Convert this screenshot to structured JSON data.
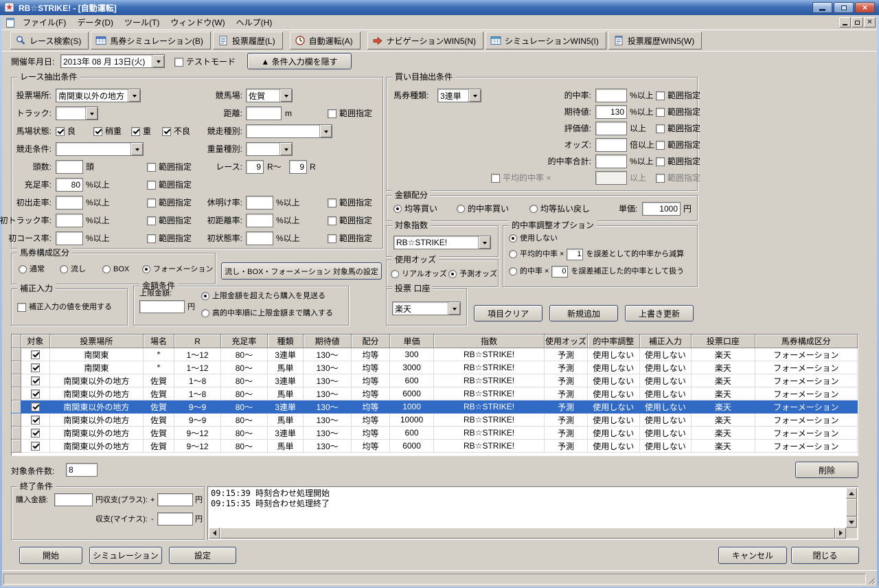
{
  "window": {
    "title": "RB☆STRIKE! - [自動運転]"
  },
  "menubar": {
    "items": [
      "ファイル(F)",
      "データ(D)",
      "ツール(T)",
      "ウィンドウ(W)",
      "ヘルプ(H)"
    ]
  },
  "toolbar": {
    "buttons": [
      {
        "label": "レース検索(S)",
        "icon": "search-icon"
      },
      {
        "label": "馬券シミュレーション(B)",
        "icon": "simulation-icon"
      },
      {
        "label": "投票履歴(L)",
        "icon": "history-icon"
      },
      {
        "label": "自動運転(A)",
        "icon": "clock-icon"
      },
      {
        "label": "ナビゲーションWIN5(N)",
        "icon": "nav-arrow-icon"
      },
      {
        "label": "シミュレーションWIN5(I)",
        "icon": "simulation-win5-icon"
      },
      {
        "label": "投票履歴WIN5(W)",
        "icon": "history-win5-icon"
      }
    ]
  },
  "date_row": {
    "label": "開催年月日:",
    "value": "2013年 08 月 13日(火)",
    "test_mode": "テストモード",
    "hide_button": "▲ 条件入力欄を隠す"
  },
  "labels": {
    "range": "範囲指定"
  },
  "race": {
    "legend": "レース抽出条件",
    "place_label": "投票場所:",
    "place_value": "南関東以外の地方",
    "course_label": "競馬場:",
    "course_value": "佐賀",
    "track_label": "トラック:",
    "track_value": "",
    "dist_label": "距離:",
    "dist_value": "",
    "dist_unit": "m",
    "baba_label": "馬場状態:",
    "baba": [
      "良",
      "稍重",
      "重",
      "不良"
    ],
    "type_label": "競走種別:",
    "type_value": "",
    "cond_label": "競走条件:",
    "cond_value": "",
    "weight_label": "重量種別:",
    "weight_value": "",
    "heads_label": "頭数:",
    "heads_value": "",
    "heads_unit": "頭",
    "raceno_label": "レース:",
    "raceno_from": "9",
    "raceno_mid": "R～",
    "raceno_to": "9",
    "raceno_unit": "R",
    "fill_label": "充足率:",
    "fill_value": "80",
    "fill_unit": "%以上",
    "firstrun_label": "初出走率:",
    "firstrun_value": "",
    "firstrun_unit": "%以上",
    "rest_label": "休明け率:",
    "rest_value": "",
    "rest_unit": "%以上",
    "firsttrack_label": "初トラック率:",
    "firsttrack_value": "",
    "firsttrack_unit": "%以上",
    "firstdist_label": "初距離率:",
    "firstdist_value": "",
    "firstdist_unit": "%以上",
    "firstcourse_label": "初コース率:",
    "firstcourse_value": "",
    "firstcourse_unit": "%以上",
    "firststate_label": "初状態率:",
    "firststate_value": "",
    "firststate_unit": "%以上"
  },
  "bet": {
    "legend": "買い目抽出条件",
    "kind_label": "馬券種類:",
    "kind_value": "3連単",
    "hit_label": "的中率:",
    "hit_value": "",
    "hit_unit": "%以上",
    "expect_label": "期待値:",
    "expect_value": "130",
    "expect_unit": "%以上",
    "eval_label": "評価値:",
    "eval_value": "",
    "eval_unit": "以上",
    "odds_label": "オッズ:",
    "odds_value": "",
    "odds_unit": "倍以上",
    "hitsum_label": "的中率合計:",
    "hitsum_value": "",
    "hitsum_unit": "%以上",
    "avg_label": "平均的中率 ×",
    "avg_value": "",
    "avg_unit": "以上"
  },
  "alloc": {
    "legend": "金額配分",
    "options": [
      "均等買い",
      "的中率買い",
      "均等払い戻し"
    ],
    "selected": 0,
    "price_label": "単価:",
    "price_value": "1000",
    "price_unit": "円"
  },
  "index": {
    "legend": "対象指数",
    "value": "RB☆STRIKE!"
  },
  "adjust": {
    "legend": "的中率調整オプション",
    "selected": 0,
    "opt1": "使用しない",
    "opt2_pre": "平均的中率 ×",
    "opt2_value": "1",
    "opt2_post": "を誤差として的中率から減算",
    "opt3_pre": "的中率 ×",
    "opt3_value": "0",
    "opt3_post": "を誤差補正した的中率として扱う"
  },
  "odds_use": {
    "legend": "使用オッズ",
    "options": [
      "リアルオッズ",
      "予測オッズ"
    ],
    "selected": 1
  },
  "structure": {
    "legend": "馬券構成区分",
    "options": [
      "通常",
      "流し",
      "BOX",
      "フォーメーション"
    ],
    "selected": 3,
    "setup_button": "流し・BOX・フォーメーション 対象馬の設定"
  },
  "correction": {
    "legend": "補正入力",
    "check_label": "補正入力の値を使用する"
  },
  "amount": {
    "legend": "金額条件",
    "limit_label": "上限金額:",
    "limit_value": "",
    "limit_unit": "円",
    "options": [
      "上限金額を超えたら購入を見送る",
      "高的中率順に上限金額まで購入する"
    ],
    "selected": 0
  },
  "account": {
    "legend": "投票 口座",
    "value": "楽天"
  },
  "actions": {
    "clear": "項目クリア",
    "add": "新規追加",
    "update": "上書き更新"
  },
  "table": {
    "columns": [
      "対象",
      "投票場所",
      "場名",
      "R",
      "充足率",
      "種類",
      "期待値",
      "配分",
      "単価",
      "指数",
      "使用オッズ",
      "的中率調整",
      "補正入力",
      "投票口座",
      "馬券構成区分"
    ],
    "selected_row": 4,
    "rows": [
      {
        "checked": true,
        "cells": [
          "南関東",
          "*",
          "1～12",
          "80～",
          "3連単",
          "130～",
          "均等",
          "300",
          "RB☆STRIKE!",
          "予測",
          "使用しない",
          "使用しない",
          "楽天",
          "フォーメーション"
        ]
      },
      {
        "checked": true,
        "cells": [
          "南関東",
          "*",
          "1～12",
          "80～",
          "馬単",
          "130～",
          "均等",
          "3000",
          "RB☆STRIKE!",
          "予測",
          "使用しない",
          "使用しない",
          "楽天",
          "フォーメーション"
        ]
      },
      {
        "checked": true,
        "cells": [
          "南関東以外の地方",
          "佐賀",
          "1～8",
          "80～",
          "3連単",
          "130～",
          "均等",
          "600",
          "RB☆STRIKE!",
          "予測",
          "使用しない",
          "使用しない",
          "楽天",
          "フォーメーション"
        ]
      },
      {
        "checked": true,
        "cells": [
          "南関東以外の地方",
          "佐賀",
          "1～8",
          "80～",
          "馬単",
          "130～",
          "均等",
          "6000",
          "RB☆STRIKE!",
          "予測",
          "使用しない",
          "使用しない",
          "楽天",
          "フォーメーション"
        ]
      },
      {
        "checked": true,
        "cells": [
          "南関東以外の地方",
          "佐賀",
          "9～9",
          "80～",
          "3連単",
          "130～",
          "均等",
          "1000",
          "RB☆STRIKE!",
          "予測",
          "使用しない",
          "使用しない",
          "楽天",
          "フォーメーション"
        ]
      },
      {
        "checked": true,
        "cells": [
          "南関東以外の地方",
          "佐賀",
          "9～9",
          "80～",
          "馬単",
          "130～",
          "均等",
          "10000",
          "RB☆STRIKE!",
          "予測",
          "使用しない",
          "使用しない",
          "楽天",
          "フォーメーション"
        ]
      },
      {
        "checked": true,
        "cells": [
          "南関東以外の地方",
          "佐賀",
          "9～12",
          "80～",
          "3連単",
          "130～",
          "均等",
          "600",
          "RB☆STRIKE!",
          "予測",
          "使用しない",
          "使用しない",
          "楽天",
          "フォーメーション"
        ]
      },
      {
        "checked": true,
        "cells": [
          "南関東以外の地方",
          "佐賀",
          "9～12",
          "80～",
          "馬単",
          "130～",
          "均等",
          "6000",
          "RB☆STRIKE!",
          "予測",
          "使用しない",
          "使用しない",
          "楽天",
          "フォーメーション"
        ]
      }
    ]
  },
  "count": {
    "label": "対象条件数:",
    "value": "8"
  },
  "delete_button": "削除",
  "end": {
    "legend": "終了条件",
    "buy_label": "購入金額:",
    "buy_value": "",
    "buy_unit": "円",
    "plus_label": "収支(プラス):",
    "plus_sign": "+",
    "plus_value": "",
    "plus_unit": "円",
    "minus_label": "収支(マイナス):",
    "minus_sign": "-",
    "minus_value": "",
    "minus_unit": "円"
  },
  "log": {
    "lines": [
      "09:15:39 時刻合わせ処理開始",
      "09:15:35 時刻合わせ処理終了"
    ]
  },
  "footer": {
    "start": "開始",
    "simulation": "シミュレーション",
    "settings": "設定",
    "cancel": "キャンセル",
    "close": "閉じる"
  }
}
